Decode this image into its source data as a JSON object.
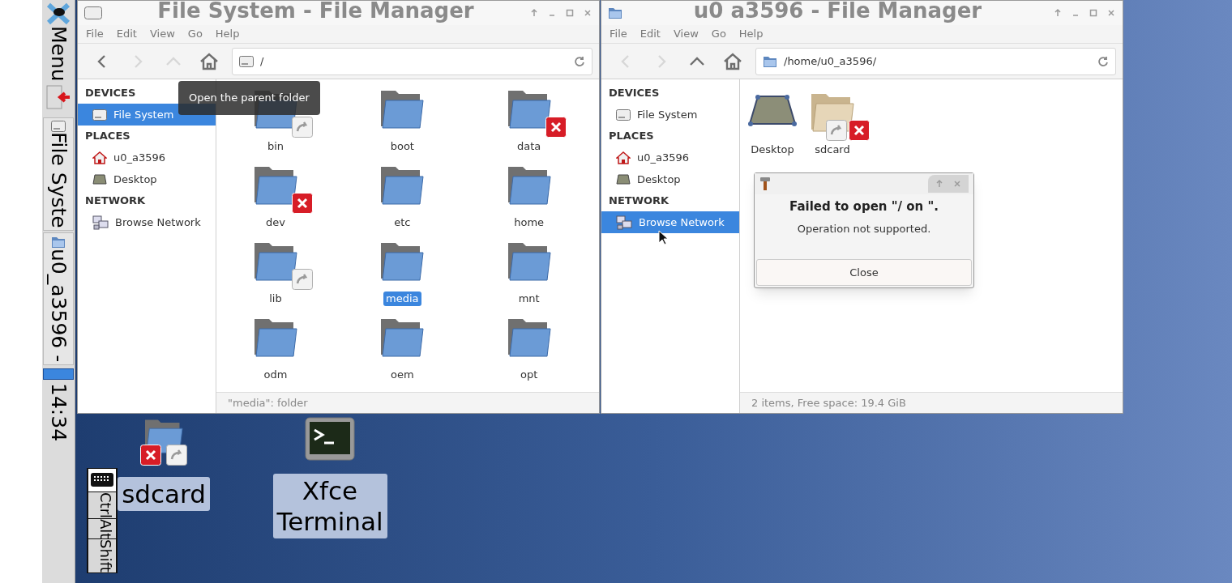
{
  "panel": {
    "menu_label": "Menu",
    "tasks": [
      {
        "label": "File Syste",
        "kind": "drive"
      },
      {
        "label": "u0_a3596 -",
        "kind": "home"
      }
    ],
    "clock": "14:34"
  },
  "keyboard": {
    "keys": [
      "Ctrl",
      "Alt",
      "Shift"
    ]
  },
  "windows": [
    {
      "title": "File System - File Manager",
      "kind": "drive",
      "menu": [
        "File",
        "Edit",
        "View",
        "Go",
        "Help"
      ],
      "nav": [
        {
          "kind": "back",
          "disabled": false
        },
        {
          "kind": "forward",
          "disabled": true
        },
        {
          "kind": "up",
          "disabled": true
        },
        {
          "kind": "home",
          "disabled": false
        }
      ],
      "path": "/",
      "sidebar": [
        {
          "heading": "DEVICES",
          "items": [
            {
              "label": "File System",
              "kind": "drive",
              "selected": true
            }
          ]
        },
        {
          "heading": "PLACES",
          "items": [
            {
              "label": "u0_a3596",
              "kind": "home",
              "selected": false
            },
            {
              "label": "Desktop",
              "kind": "desktop",
              "selected": false
            }
          ]
        },
        {
          "heading": "NETWORK",
          "items": [
            {
              "label": "Browse Network",
              "kind": "network",
              "selected": false
            }
          ]
        }
      ],
      "files": [
        {
          "name": "bin",
          "kind": "folder",
          "linked": true,
          "denied": false,
          "selected": false
        },
        {
          "name": "boot",
          "kind": "folder",
          "linked": false,
          "denied": false,
          "selected": false
        },
        {
          "name": "data",
          "kind": "folder",
          "linked": false,
          "denied": true,
          "selected": false
        },
        {
          "name": "dev",
          "kind": "folder",
          "linked": false,
          "denied": true,
          "selected": false
        },
        {
          "name": "etc",
          "kind": "folder",
          "linked": false,
          "denied": false,
          "selected": false
        },
        {
          "name": "home",
          "kind": "folder",
          "linked": false,
          "denied": false,
          "selected": false
        },
        {
          "name": "lib",
          "kind": "folder",
          "linked": true,
          "denied": false,
          "selected": false
        },
        {
          "name": "media",
          "kind": "folder",
          "linked": false,
          "denied": false,
          "selected": true
        },
        {
          "name": "mnt",
          "kind": "folder",
          "linked": false,
          "denied": false,
          "selected": false
        },
        {
          "name": "odm",
          "kind": "folder",
          "linked": false,
          "denied": false,
          "selected": false
        },
        {
          "name": "oem",
          "kind": "folder",
          "linked": false,
          "denied": false,
          "selected": false
        },
        {
          "name": "opt",
          "kind": "folder",
          "linked": false,
          "denied": false,
          "selected": false
        }
      ],
      "status": "\"media\": folder",
      "tooltip": "Open the parent folder"
    },
    {
      "title": "u0 a3596 - File Manager",
      "kind": "home",
      "menu": [
        "File",
        "Edit",
        "View",
        "Go",
        "Help"
      ],
      "nav": [
        {
          "kind": "back",
          "disabled": true
        },
        {
          "kind": "forward",
          "disabled": true
        },
        {
          "kind": "up",
          "disabled": false
        },
        {
          "kind": "home",
          "disabled": false
        }
      ],
      "path": "/home/u0_a3596/",
      "sidebar": [
        {
          "heading": "DEVICES",
          "items": [
            {
              "label": "File System",
              "kind": "drive",
              "selected": false
            }
          ]
        },
        {
          "heading": "PLACES",
          "items": [
            {
              "label": "u0_a3596",
              "kind": "home",
              "selected": false
            },
            {
              "label": "Desktop",
              "kind": "desktop",
              "selected": false
            }
          ]
        },
        {
          "heading": "NETWORK",
          "items": [
            {
              "label": "Browse Network",
              "kind": "network",
              "selected": true
            }
          ]
        }
      ],
      "files": [
        {
          "name": "Desktop",
          "kind": "desktop",
          "linked": false,
          "denied": false,
          "selected": false
        },
        {
          "name": "sdcard",
          "kind": "tan-folder",
          "linked": true,
          "denied": true,
          "selected": false
        }
      ],
      "status": "2 items, Free space: 19.4 GiB"
    }
  ],
  "dialog": {
    "heading": "Failed to open \"/ on \".",
    "message": "Operation not supported.",
    "button": "Close"
  },
  "desktop_icons": [
    {
      "label": "sdcard",
      "kind": "folder",
      "linked": true,
      "denied": true
    },
    {
      "label": "Xfce Terminal",
      "kind": "terminal",
      "linked": false,
      "denied": false
    }
  ]
}
